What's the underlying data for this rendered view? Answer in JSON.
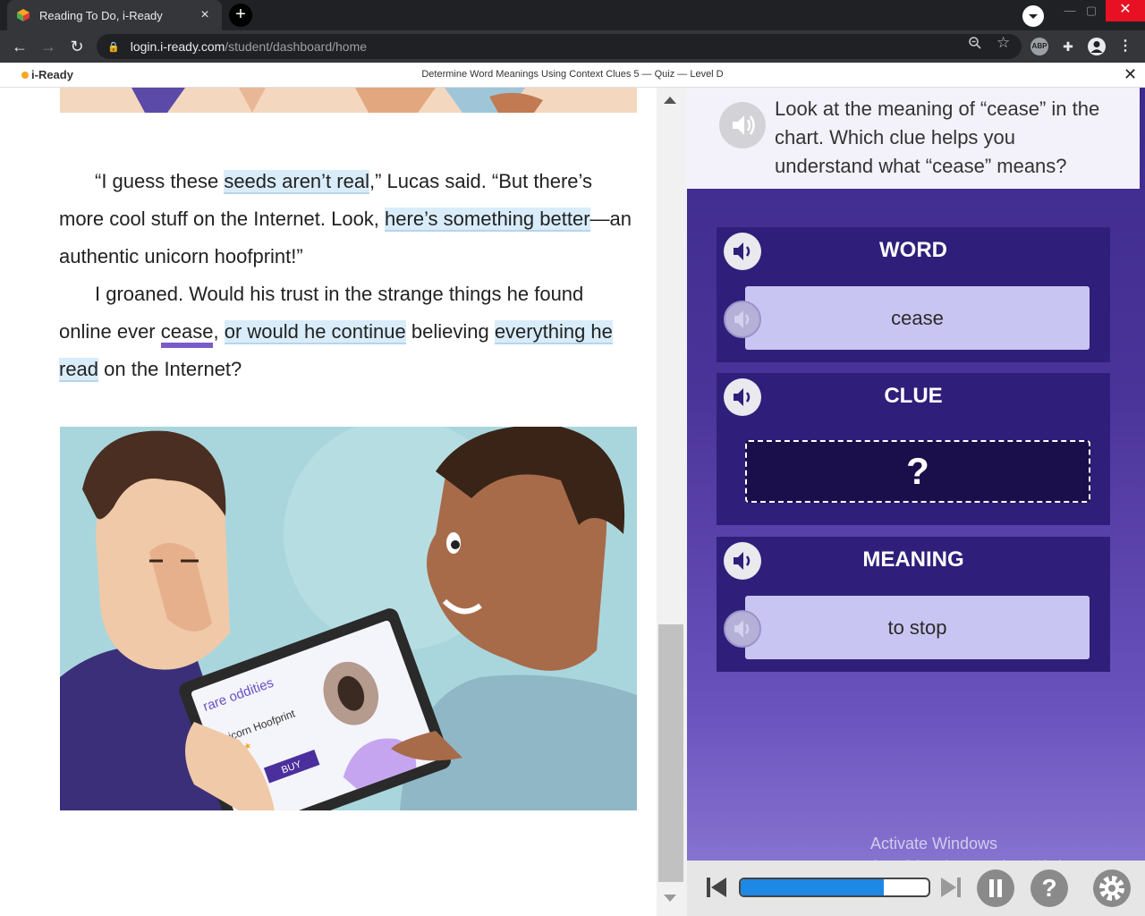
{
  "browser": {
    "tab_title": "Reading To Do, i-Ready",
    "new_tab": "+",
    "url_host": "login.i-ready.com",
    "url_path": "/student/dashboard/home",
    "ext_abp": "ABP"
  },
  "app": {
    "logo": "i-Ready",
    "quiz_title": "Determine Word Meanings Using Context Clues 5 — Quiz — Level D",
    "close": "✕"
  },
  "passage": {
    "p1_a": "“I guess these ",
    "p1_hl1": "seeds aren’t real",
    "p1_b": ",” Lucas said. “But there’s more cool stuff on the Internet. Look, ",
    "p1_hl2": "here’s something better",
    "p1_c": "—an authentic unicorn hoofprint!”",
    "p2_a": "I groaned. Would his trust in the strange things he found online ever ",
    "p2_word": "cease",
    "p2_b": ", ",
    "p2_hl1": "or would he continue",
    "p2_c": " believing ",
    "p2_hl2": "everything he read",
    "p2_d": " on the Internet?"
  },
  "illustration": {
    "tablet_heading": "rare oddities",
    "product": "Unicorn Hoofprint",
    "buy": "BUY"
  },
  "question": {
    "text": "Look at the meaning of “cease” in the chart. Which clue helps you understand what “cease” means?"
  },
  "chart": {
    "word_title": "WORD",
    "word_value": "cease",
    "clue_title": "CLUE",
    "clue_value": "?",
    "meaning_title": "MEANING",
    "meaning_value": "to stop"
  },
  "watermark": {
    "title": "Activate Windows",
    "subtitle": "Go to PC settings to activate Windows."
  },
  "controls": {
    "progress_percent": 76,
    "help": "?"
  },
  "colors": {
    "accent_purple": "#3e2a8c",
    "highlight": "#d9ecfa",
    "progress": "#1e88e5"
  }
}
